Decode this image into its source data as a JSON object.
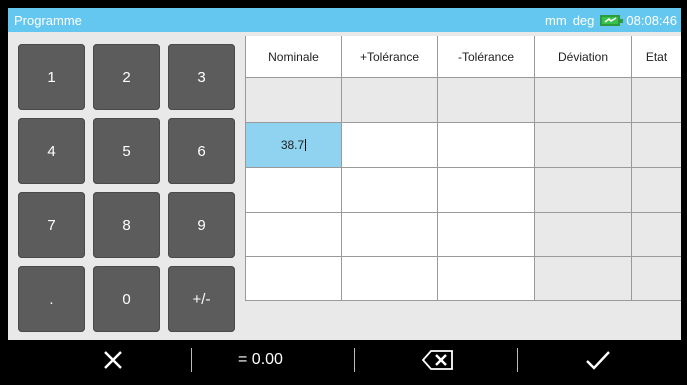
{
  "titlebar": {
    "title": "Programme",
    "units": "mm",
    "angle": "deg",
    "time": "08:08:46",
    "battery_color": "#36c24b",
    "bar_color": "#64c7ef"
  },
  "keypad": {
    "keys": [
      "1",
      "2",
      "3",
      "4",
      "5",
      "6",
      "7",
      "8",
      "9",
      ".",
      "0",
      "+/-"
    ]
  },
  "table": {
    "headers": [
      "Nominale",
      "+Tolérance",
      "-Tolérance",
      "Déviation",
      "Etat"
    ],
    "active_value": "38.7"
  },
  "bottombar": {
    "cancel_icon": "close-icon",
    "result": "= 0.00",
    "backspace_icon": "backspace-icon",
    "confirm_icon": "check-icon"
  }
}
